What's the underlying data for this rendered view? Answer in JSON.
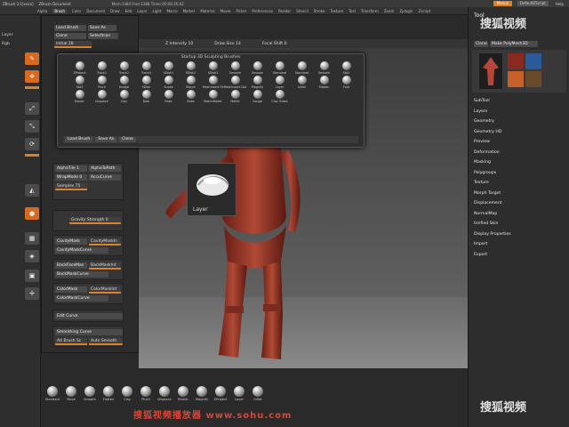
{
  "titlebar": {
    "app": "ZBrush 3.1[xxxx]",
    "doc": "ZBrush Document",
    "stats": "Mem:1484 Free:1388 Timer:00:00:26:02",
    "menus": "Menus",
    "script": "DefaultZScript",
    "help": "Help"
  },
  "menubar": [
    "Alpha",
    "Brush",
    "Color",
    "Document",
    "Draw",
    "Edit",
    "Layer",
    "Light",
    "Macro",
    "Marker",
    "Material",
    "Movie",
    "Picker",
    "Preferences",
    "Render",
    "Stencil",
    "Stroke",
    "Texture",
    "Tool",
    "Transform",
    "Zoom",
    "Zplugin",
    "Zscript"
  ],
  "leftbar": {
    "layer_label": "Layer",
    "rgb_label": "Rgb",
    "buttons": [
      "Edit",
      "Draw",
      "Move",
      "Scale",
      "Rotate",
      "Persp",
      "Floor",
      "Local",
      "Frame"
    ]
  },
  "toolpanel": {
    "load_brush": "Load Brush",
    "save_as": "Save As",
    "clone": "Clone",
    "select_icon": "SelectIcon",
    "initial": "Initial 28",
    "z_intensity": "Z Intensity 10",
    "draw_size": "Draw Size 14",
    "focal_shift": "Focal Shift 0",
    "alpha_tile": "AlphaTile 1",
    "alpha_to_path": "AlphaToPath",
    "wrap_mode": "WrapMode 0",
    "accu_curve": "AccuCurve",
    "samples": "Samples 75",
    "gravity_strength": "Gravity Strength 0",
    "cavity_mask": "CavityMask",
    "cavity_mask_int": "CavityMaskIn",
    "cavity_mask_curve": "CavityMaskCurve",
    "back_face_mask": "BackFaceMas",
    "back_mask_int": "BackMaskInt",
    "back_mask_curve": "BackMaskCurve",
    "color_mask": "ColorMask",
    "color_mask_int": "ColorMaskInt",
    "color_mask_curve": "ColorMaskCurve",
    "edit_curve": "Edit Curve",
    "smoothing_curve": "Smoothing Curve",
    "alt_brush": "Alt Brush Sc",
    "auto_smooth": "Auto Smooth"
  },
  "brushpop": {
    "title": "Startup 3D Sculpting Brushes",
    "brushes": [
      "ZProject",
      "Track1",
      "Track2",
      "Track3",
      "SDisk1",
      "SDisk2",
      "SDisk3",
      "Smooth",
      "Smooth",
      "Standard",
      "Standard",
      "Smooth",
      "Std2",
      "Std3",
      "Pinch",
      "Nudge",
      "SDisk",
      "Snake",
      "Morph",
      "MeshInsert Fit",
      "MeshInsert Dot",
      "Magnify",
      "Layer",
      "Inflat",
      "Flatten",
      "Fold",
      "Elastic",
      "Displace",
      "Clay",
      "Blob",
      "Rake",
      "Rake",
      "MatchMaker",
      "Mallet",
      "Gouge",
      "Clay Tubes"
    ],
    "footer": [
      "Load Brush",
      "Save As",
      "Clone"
    ]
  },
  "tooltip": {
    "label": "Layer"
  },
  "rightpanel": {
    "title": "Tool",
    "buttons": [
      "Clone",
      "Make PolyMesh3D"
    ],
    "items": [
      "SubTool",
      "Layers",
      "Geometry",
      "Geometry HD",
      "Preview",
      "Deformation",
      "Masking",
      "Polygroups",
      "Texture",
      "Morph Target",
      "Displacement",
      "NormalMap",
      "Unified Skin",
      "Display Properties",
      "Import",
      "Export"
    ],
    "thumbs": [
      "AlphaBr",
      "SimpleBr",
      "EraserBr"
    ]
  },
  "shelf": [
    "Standard",
    "Move",
    "Smooth",
    "Flatten",
    "Clay",
    "Pinch",
    "Displace",
    "Elastic",
    "Magnify",
    "ZProject",
    "Layer",
    "Inflat"
  ],
  "watermark": "搜狐视频播放器 www.sohu.com",
  "logo": "搜狐视频"
}
